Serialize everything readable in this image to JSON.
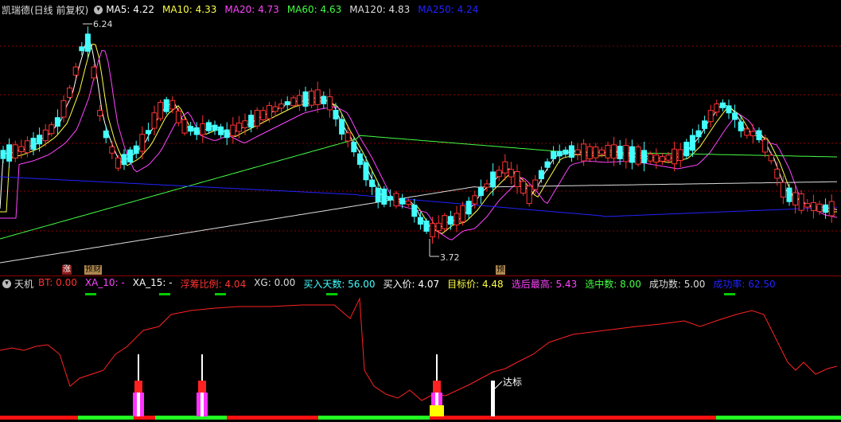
{
  "main_header": {
    "title": "凯瑞德(日线 前复权)",
    "items": [
      {
        "label": "MA5: 4.22",
        "color": "#ffffff"
      },
      {
        "label": "MA10: 4.33",
        "color": "#ffff44"
      },
      {
        "label": "MA20: 4.73",
        "color": "#ff44ff"
      },
      {
        "label": "MA60: 4.63",
        "color": "#44ff44"
      },
      {
        "label": "MA120: 4.83",
        "color": "#dddddd"
      },
      {
        "label": "MA250: 4.24",
        "color": "#2222ff"
      }
    ]
  },
  "price_labels": {
    "high": "6.24",
    "low": "3.72"
  },
  "event_tags": [
    {
      "text": "涨",
      "bg": "#8b1a1a",
      "color": "#ffffff"
    },
    {
      "text": "预",
      "bg": "#b08850",
      "color": "#000000"
    },
    {
      "text": "财",
      "bg": "#b08850",
      "color": "#000000"
    },
    {
      "text": "预",
      "bg": "#b08850",
      "color": "#000000"
    }
  ],
  "sub_header": {
    "title": "天机",
    "items": [
      {
        "label": "BT: 0.00",
        "color": "#ff3333"
      },
      {
        "label": "XA_10: -",
        "color": "#ff44ff"
      },
      {
        "label": "XA_15: -",
        "color": "#ffffff"
      },
      {
        "label": "浮筹比例: 4.04",
        "color": "#ff3333"
      },
      {
        "label": "XG: 0.00",
        "color": "#dddddd"
      },
      {
        "label": "买入天数: 56.00",
        "color": "#44ffff"
      },
      {
        "label": "买入价: 4.07",
        "color": "#ffffff"
      },
      {
        "label": "目标价: 4.48",
        "color": "#ffff44"
      },
      {
        "label": "选后最高: 5.43",
        "color": "#ff44ff"
      },
      {
        "label": "选中数: 8.00",
        "color": "#44ff44"
      },
      {
        "label": "成功数: 5.00",
        "color": "#dddddd"
      },
      {
        "label": "成功率: 62.50",
        "color": "#2222ff"
      }
    ]
  },
  "indicator_label": "达标",
  "colors": {
    "up": "#ff3333",
    "down": "#44ffff",
    "grid": "#8b0000"
  }
}
